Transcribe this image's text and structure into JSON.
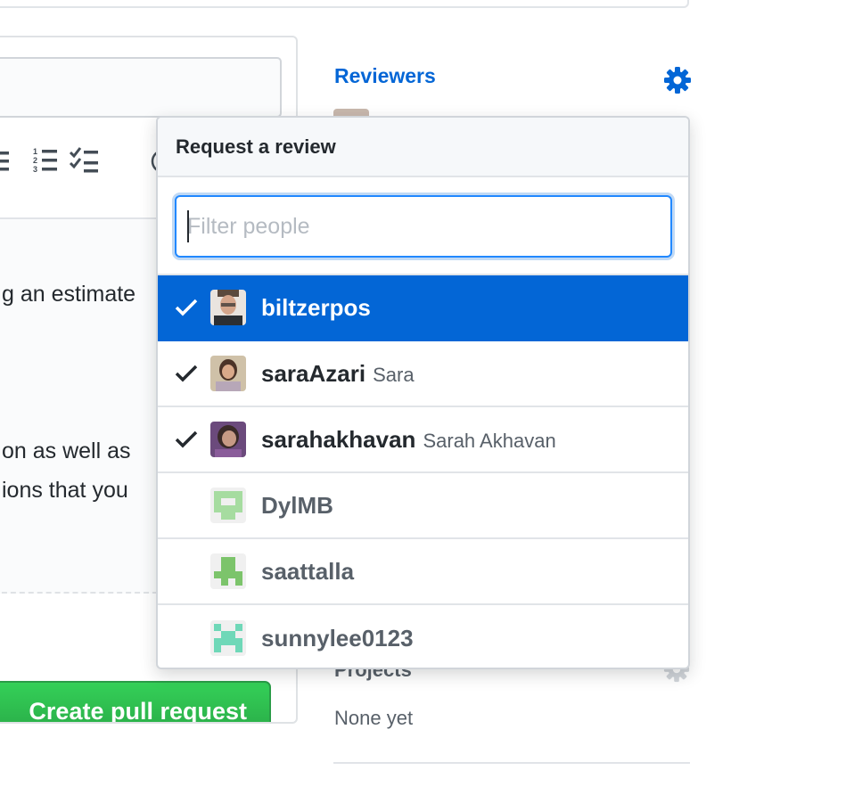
{
  "composer": {
    "body_lines": [
      "g an estimate",
      "on as well as",
      "ions that you"
    ],
    "create_button": "Create pull request"
  },
  "sidebar": {
    "reviewers_title": "Reviewers",
    "projects_title": "Projects",
    "projects_value": "None yet"
  },
  "popover": {
    "header": "Request a review",
    "filter_placeholder": "Filter people",
    "people": [
      {
        "login": "biltzerpos",
        "name": "",
        "checked": true,
        "highlighted": true
      },
      {
        "login": "saraAzari",
        "name": "Sara",
        "checked": true,
        "highlighted": false
      },
      {
        "login": "sarahakhavan",
        "name": "Sarah Akhavan",
        "checked": true,
        "highlighted": false
      },
      {
        "login": "DylMB",
        "name": "",
        "checked": false,
        "highlighted": false
      },
      {
        "login": "saattalla",
        "name": "",
        "checked": false,
        "highlighted": false
      },
      {
        "login": "sunnylee0123",
        "name": "",
        "checked": false,
        "highlighted": false
      }
    ]
  },
  "colors": {
    "accent": "#0366d6",
    "create_green": "#28a745"
  },
  "icons": [
    "unordered-list-icon",
    "ordered-list-icon",
    "task-list-icon",
    "gear-icon",
    "check-icon"
  ]
}
